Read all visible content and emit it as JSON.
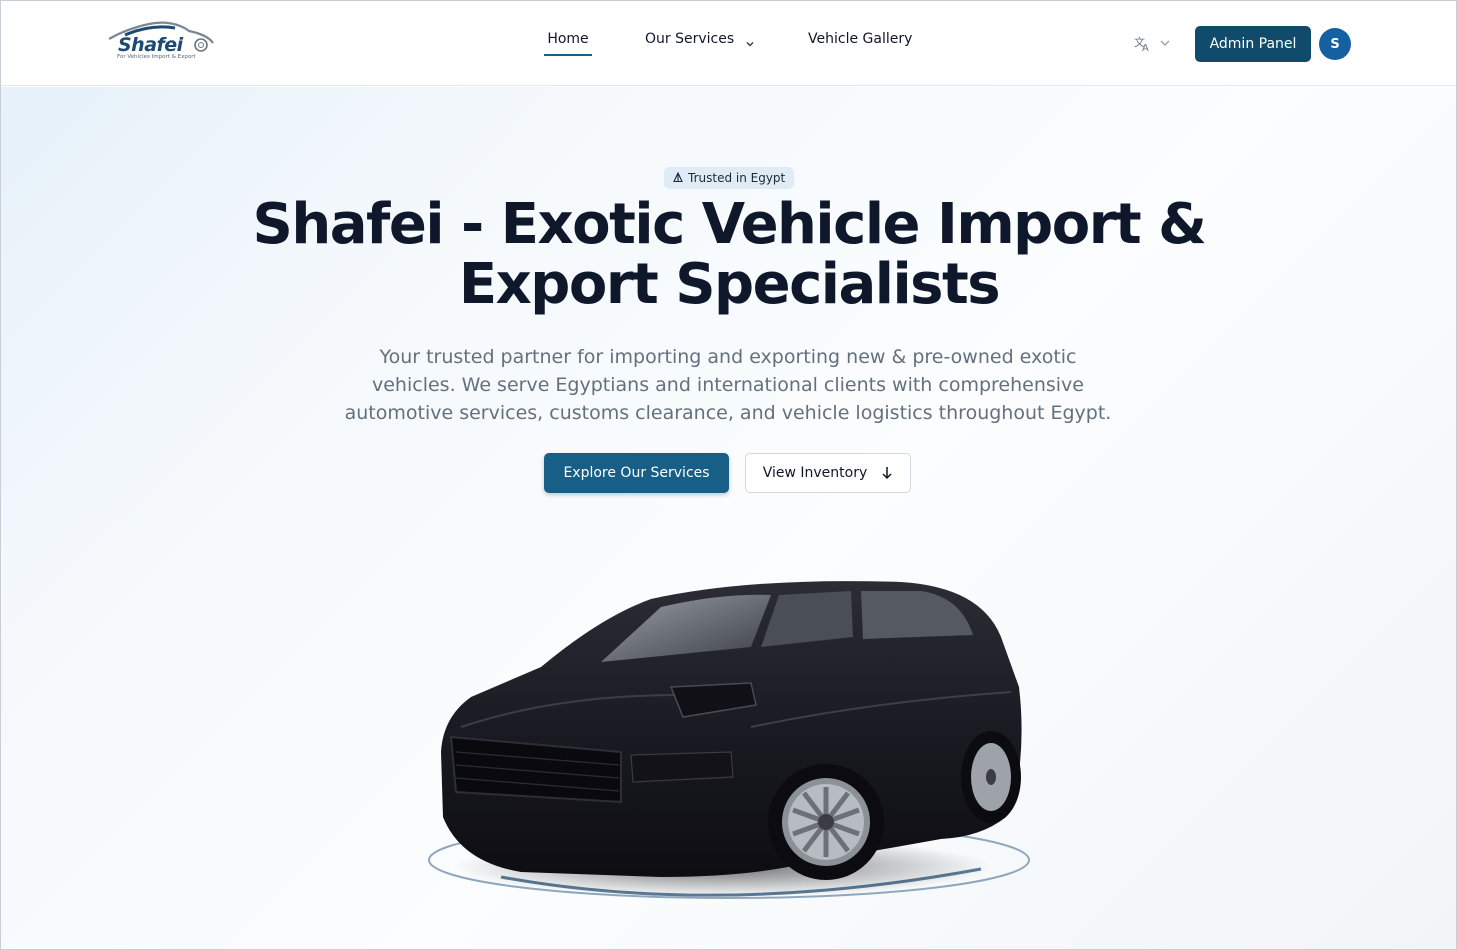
{
  "header": {
    "logo": {
      "wordmark": "Shafei",
      "tagline": "For Vehicles Import & Export"
    },
    "nav": {
      "home": "Home",
      "services": "Our Services",
      "gallery": "Vehicle Gallery"
    },
    "language_icon": "translate-icon",
    "admin_label": "Admin Panel",
    "avatar_initial": "S"
  },
  "hero": {
    "badge": "Trusted in Egypt",
    "title": "Shafei - Exotic Vehicle Import & Export Specialists",
    "subtitle": "Your trusted partner for importing and exporting new & pre-owned exotic vehicles. We serve Egyptians and international clients with comprehensive automotive services, customs clearance, and vehicle logistics throughout Egypt.",
    "primary_cta": "Explore Our Services",
    "secondary_cta": "View Inventory"
  },
  "colors": {
    "brand": "#114b6b",
    "cta": "#175f86",
    "avatar": "#1560a0",
    "text": "#0f172a",
    "muted": "#64707d"
  }
}
